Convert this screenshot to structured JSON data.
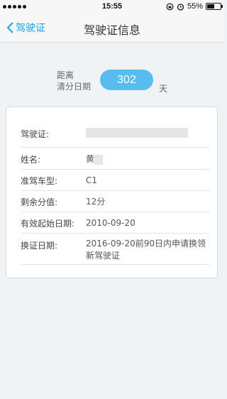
{
  "status_bar": {
    "time": "15:55",
    "battery": "55%",
    "battery_level": 0.55,
    "icons": [
      "lock-rotation-icon",
      "alarm-icon",
      "battery-icon"
    ]
  },
  "nav": {
    "back_label": "驾驶证",
    "title": "驾驶证信息"
  },
  "countdown": {
    "label_line1": "距离",
    "label_line2": "清分日期",
    "days": "302",
    "unit": "天"
  },
  "license": {
    "fields": [
      {
        "label": "驾驶证:",
        "value": ""
      },
      {
        "label": "姓名:",
        "value": "黄"
      },
      {
        "label": "准驾车型:",
        "value": "C1"
      },
      {
        "label": "剩余分值:",
        "value": "12分"
      },
      {
        "label": "有效起始日期:",
        "value": "2010-09-20"
      },
      {
        "label": "换证日期:",
        "value": "2016-09-20前90日内申请换领新驾驶证"
      }
    ]
  },
  "colors": {
    "accent": "#1aa0e8",
    "pill": "#57bdee",
    "background": "#eff3f5"
  }
}
